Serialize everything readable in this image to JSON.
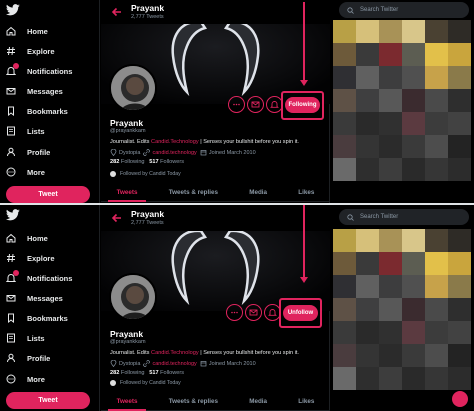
{
  "sidebar": {
    "items": [
      {
        "label": "Home",
        "icon": "home-icon"
      },
      {
        "label": "Explore",
        "icon": "hashtag-icon"
      },
      {
        "label": "Notifications",
        "icon": "bell-icon"
      },
      {
        "label": "Messages",
        "icon": "mail-icon"
      },
      {
        "label": "Bookmarks",
        "icon": "bookmark-icon"
      },
      {
        "label": "Lists",
        "icon": "list-icon"
      },
      {
        "label": "Profile",
        "icon": "person-icon"
      },
      {
        "label": "More",
        "icon": "more-circle-icon"
      }
    ],
    "tweet_label": "Tweet"
  },
  "header": {
    "name": "Prayank",
    "tweets": "2,777 Tweets"
  },
  "profile": {
    "name": "Prayank",
    "handle": "@prayankkam",
    "bio_pre": "Journalist. Edits ",
    "bio_link": "Candid.Technology",
    "bio_post": " | Senses your bullshit before you spin it.",
    "location": "Dystopia",
    "website": "candid.technology",
    "joined": "Joined March 2010",
    "following_count": "282",
    "following_label": "Following",
    "followers_count": "517",
    "followers_label": "Followers",
    "followed_by": "Followed by Candid Today"
  },
  "tabs": [
    "Tweets",
    "Tweets & replies",
    "Media",
    "Likes"
  ],
  "top_button": "Following",
  "bottom_button": "Unfollow",
  "search": {
    "placeholder": "Search Twitter"
  },
  "colors": {
    "accent": "#e0245e",
    "background": "#000000",
    "muted_text": "#8b98a5",
    "mosaic": [
      "#b8a046",
      "#d6c07a",
      "#a89257",
      "#d8c68a",
      "#4a4132",
      "#2e2b26",
      "#6d5a3a",
      "#3a3a3a",
      "#7b2a2f",
      "#5c5d52",
      "#e2c04a",
      "#c9a53d",
      "#2f2f33",
      "#606060",
      "#3d3d3e",
      "#505050",
      "#c7a24a",
      "#8a7a4a",
      "#5e5146",
      "#3f3f40",
      "#585858",
      "#3b2b2f",
      "#4a4a4a",
      "#2e2e2e",
      "#3a3a3a",
      "#2a2a2a",
      "#303030",
      "#5b3a40",
      "#3c3c3c",
      "#424242",
      "#4a3c3e",
      "#343434",
      "#2b2b2b",
      "#3a3a3a",
      "#4d4d4d",
      "#232323",
      "#6a6a6a",
      "#2e2e2e",
      "#3d3d3d",
      "#2a2a2a",
      "#363636",
      "#2c2c2c"
    ]
  }
}
